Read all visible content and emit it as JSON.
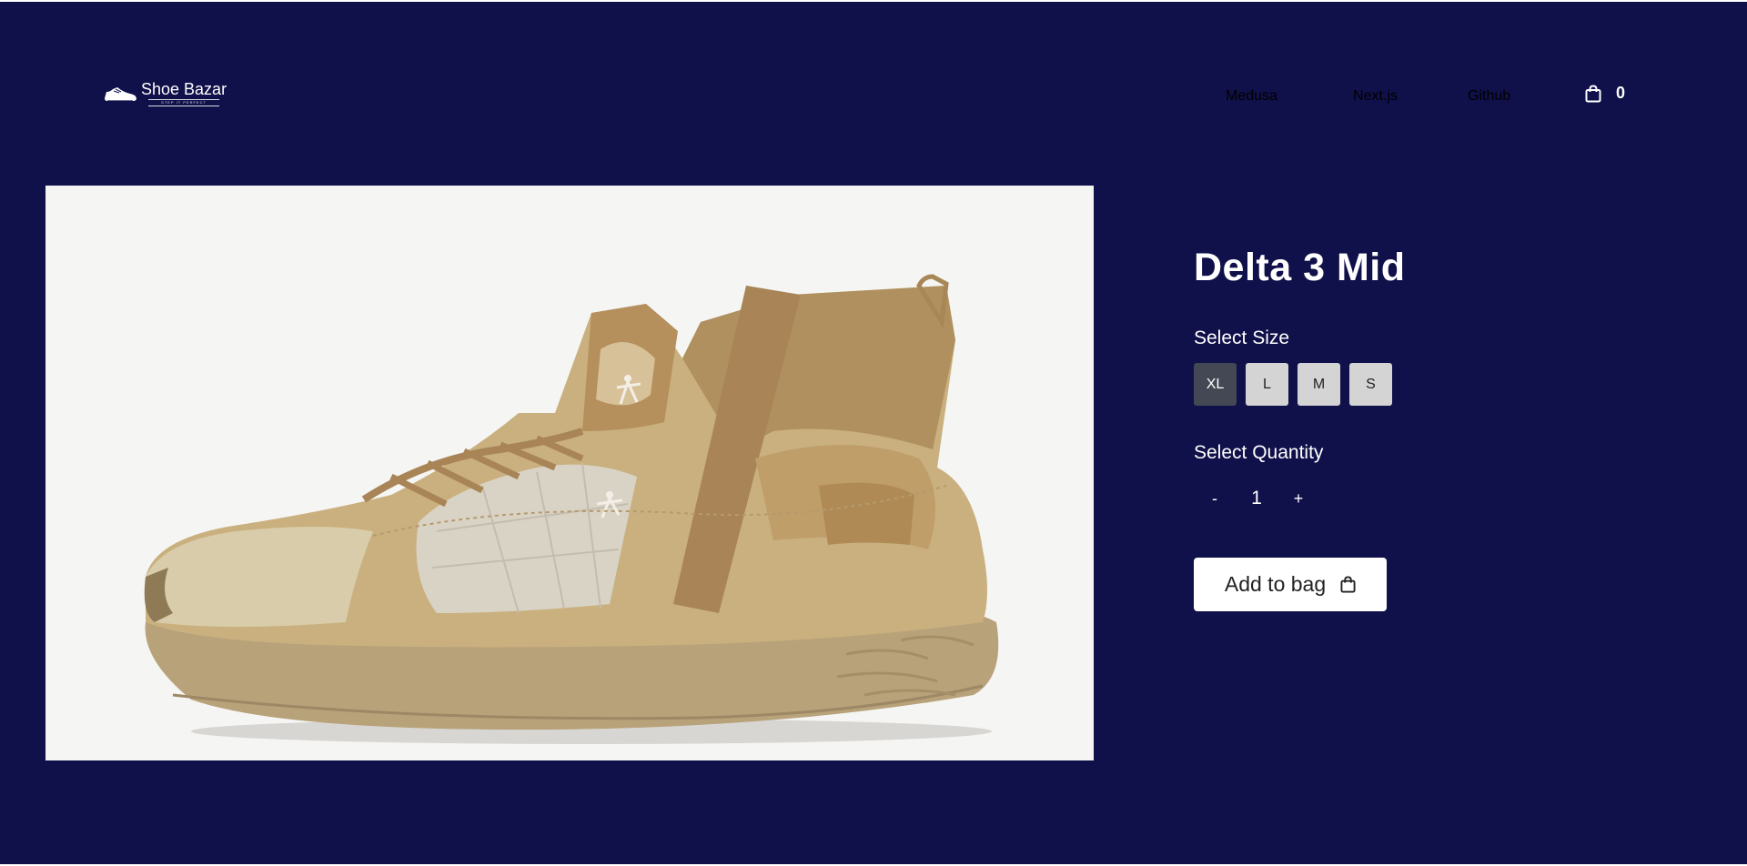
{
  "header": {
    "logo": {
      "name": "Shoe Bazar",
      "tagline": "STEP IT PERFECT"
    },
    "nav": [
      {
        "label": "Medusa"
      },
      {
        "label": "Next.js"
      },
      {
        "label": "Github"
      }
    ],
    "cart": {
      "icon": "shopping-bag-icon",
      "count": "0"
    }
  },
  "product": {
    "title": "Delta 3 Mid",
    "image": {
      "subject": "shoe"
    },
    "size_label": "Select Size",
    "sizes": [
      {
        "label": "XL",
        "selected": true
      },
      {
        "label": "L",
        "selected": false
      },
      {
        "label": "M",
        "selected": false
      },
      {
        "label": "S",
        "selected": false
      }
    ],
    "quantity_label": "Select Quantity",
    "quantity": {
      "decrement": "-",
      "value": "1",
      "increment": "+"
    },
    "add_to_bag": {
      "label": "Add to bag",
      "icon": "shopping-bag-icon"
    }
  },
  "colors": {
    "background": "#10104a",
    "selected_size": "#434854",
    "size_button": "#d4d4d4",
    "image_bg": "#f5f5f4",
    "shoe_tan": "#c9b07e"
  }
}
